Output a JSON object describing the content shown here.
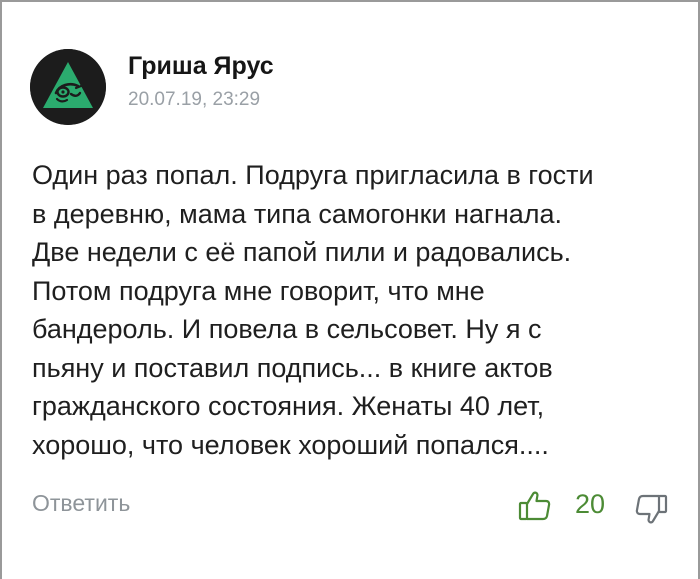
{
  "comment": {
    "author": "Гриша Ярус",
    "date": "20.07.19, 23:29",
    "text_lines": [
      "Один раз попал. Подруга пригласила в гости",
      "в деревню, мама типа самогонки нагнала.",
      "Две недели с её папой пили и радовались.",
      "Потом подруга мне говорит, что мне",
      "бандероль. И повела в сельсовет. Ну я с",
      "пьяну и поставил подпись... в книге актов",
      "гражданского состояния. Женаты 40 лет,",
      "хорошо, что человек хороший попался...."
    ],
    "reply_label": "Ответить",
    "rating": "20",
    "icons": {
      "avatar": "green-triangle-eye-avatar",
      "upvote": "thumb-up-icon",
      "downvote": "thumb-down-icon"
    },
    "colors": {
      "rating": "#4c8b35",
      "avatar_bg": "#1c1c1c",
      "avatar_triangle": "#2bab6e",
      "muted_text": "#8e9499"
    }
  }
}
